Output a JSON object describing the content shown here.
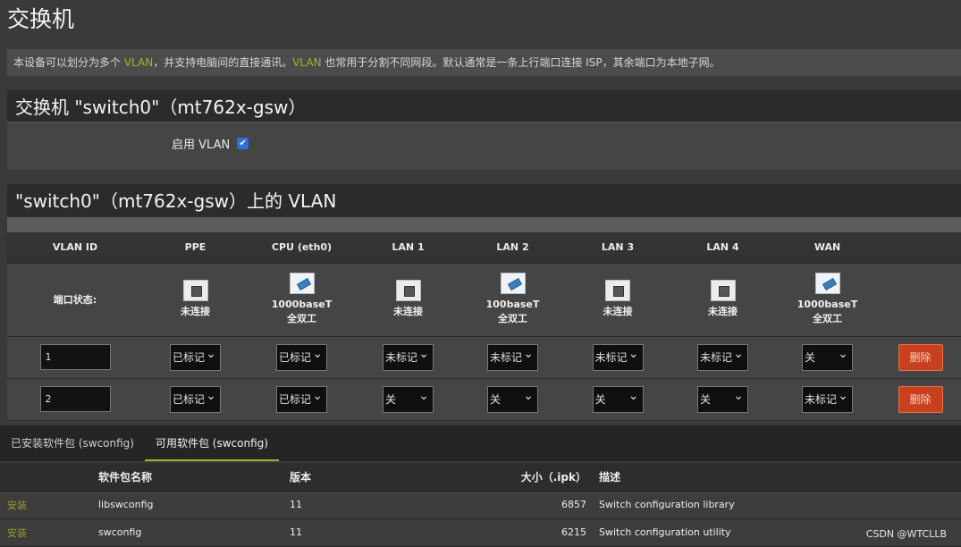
{
  "page": {
    "title": "交换机"
  },
  "description": {
    "parts": [
      "本设备可以划分为多个 ",
      "VLAN",
      "，并支持电脑间的直接通讯。",
      "VLAN",
      " 也常用于分割不同网段。默认通常是一条上行端口连接 ISP，其余端口为本地子网。"
    ]
  },
  "switch_section": {
    "title": "交换机 \"switch0\"（mt762x-gsw）",
    "enable_vlan_label": "启用 VLAN",
    "enable_vlan_checked": true
  },
  "vlan_section": {
    "title": "\"switch0\"（mt762x-gsw）上的 VLAN",
    "columns": [
      "VLAN ID",
      "PPE",
      "CPU (eth0)",
      "LAN 1",
      "LAN 2",
      "LAN 3",
      "LAN 4",
      "WAN"
    ],
    "port_status_label": "端口状态:",
    "port_status": [
      {
        "state": "down",
        "line1": "未连接",
        "line2": ""
      },
      {
        "state": "up",
        "line1": "1000baseT",
        "line2": "全双工"
      },
      {
        "state": "down",
        "line1": "未连接",
        "line2": ""
      },
      {
        "state": "up",
        "line1": "100baseT",
        "line2": "全双工"
      },
      {
        "state": "down",
        "line1": "未连接",
        "line2": ""
      },
      {
        "state": "down",
        "line1": "未连接",
        "line2": ""
      },
      {
        "state": "up",
        "line1": "1000baseT",
        "line2": "全双工"
      }
    ],
    "rows": [
      {
        "vlan_id": "1",
        "values": [
          "已标记",
          "已标记",
          "未标记",
          "未标记",
          "未标记",
          "未标记",
          "关"
        ]
      },
      {
        "vlan_id": "2",
        "values": [
          "已标记",
          "已标记",
          "关",
          "关",
          "关",
          "关",
          "未标记"
        ]
      }
    ],
    "delete_label": "删除"
  },
  "tabs": [
    {
      "label": "已安装软件包 (swconfig)",
      "active": false
    },
    {
      "label": "可用软件包 (swconfig)",
      "active": true
    }
  ],
  "packages": {
    "headers": [
      "",
      "软件包名称",
      "版本",
      "大小（.ipk）",
      "描述"
    ],
    "rows": [
      {
        "action": "安装",
        "name": "libswconfig",
        "version": "11",
        "size": "6857",
        "desc": "Switch configuration library"
      },
      {
        "action": "安装",
        "name": "swconfig",
        "version": "11",
        "size": "6215",
        "desc": "Switch configuration utility"
      }
    ]
  },
  "watermark": "CSDN @WTCLLB",
  "colors": {
    "accent": "#9cb526",
    "delete": "#c8401d",
    "checkbox": "#2a72d8"
  }
}
